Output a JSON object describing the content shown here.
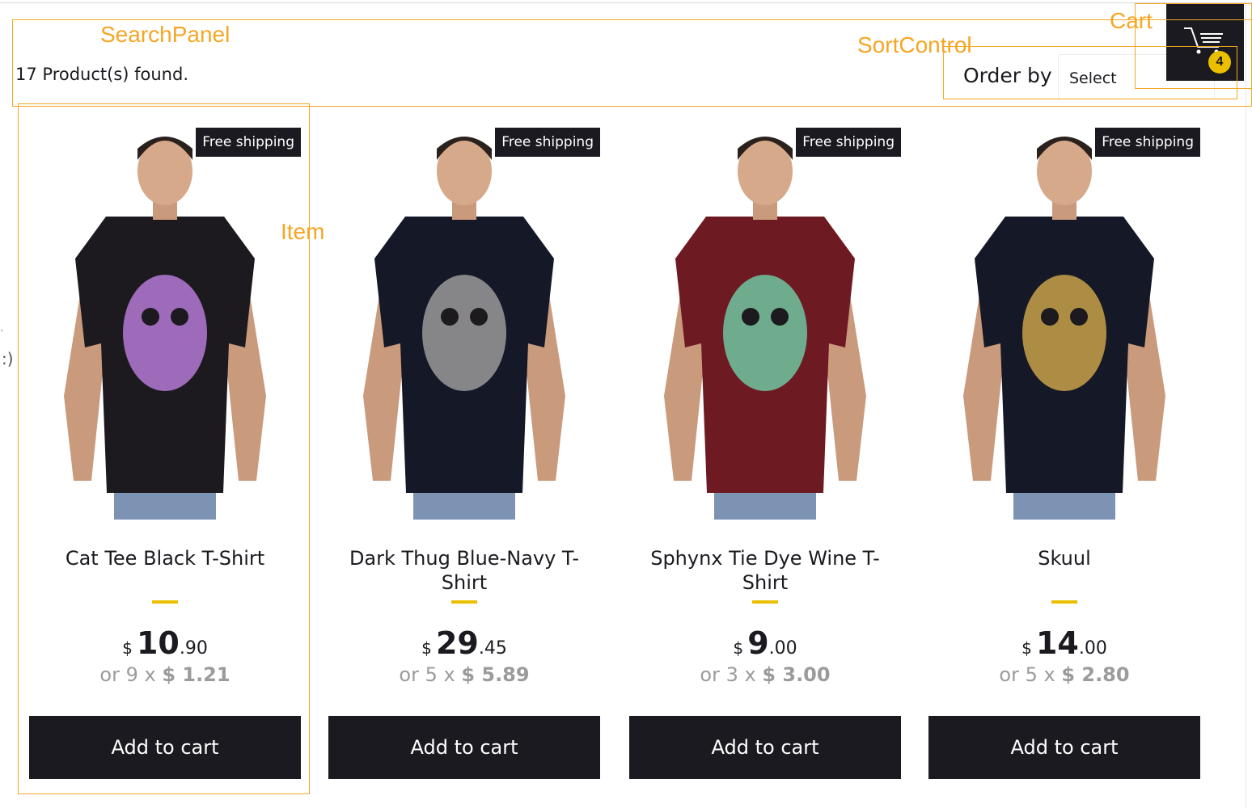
{
  "annotations": {
    "search_panel": "SearchPanel",
    "sort_control": "SortControl",
    "cart": "Cart",
    "item": "Item",
    "color": "#f5a623"
  },
  "search": {
    "products_found": "17 Product(s) found."
  },
  "sort": {
    "label": "Order by",
    "selected": "Select"
  },
  "cart": {
    "count": "4",
    "icon": "cart-icon"
  },
  "left_edge_text": ":)",
  "colors": {
    "dark": "#1b1a20",
    "accent": "#eabf00",
    "muted": "#9c9b9b"
  },
  "products": [
    {
      "badge": "Free shipping",
      "title": "Cat Tee Black T-Shirt",
      "currency": "$",
      "price_int": "10",
      "price_dec": ".90",
      "inst_prefix": "or 9 x",
      "inst_value": "$ 1.21",
      "button": "Add to cart",
      "image": "model-black-tshirt-cat-print",
      "shirt_color": "#1c1a1f",
      "print_color": "#b57ad6"
    },
    {
      "badge": "Free shipping",
      "title": "Dark Thug Blue-Navy T-Shirt",
      "currency": "$",
      "price_int": "29",
      "price_dec": ".45",
      "inst_prefix": "or 5 x",
      "inst_value": "$ 5.89",
      "button": "Add to cart",
      "image": "model-navy-tshirt-bandana-print",
      "shirt_color": "#141827",
      "print_color": "#9a9a9a"
    },
    {
      "badge": "Free shipping",
      "title": "Sphynx Tie Dye Wine T-Shirt",
      "currency": "$",
      "price_int": "9",
      "price_dec": ".00",
      "inst_prefix": "or 3 x",
      "inst_value": "$ 3.00",
      "button": "Add to cart",
      "image": "model-wine-tshirt-cat-print",
      "shirt_color": "#6e1a22",
      "print_color": "#6fc7a0"
    },
    {
      "badge": "Free shipping",
      "title": "Skuul",
      "currency": "$",
      "price_int": "14",
      "price_dec": ".00",
      "inst_prefix": "or 5 x",
      "inst_value": "$ 2.80",
      "button": "Add to cart",
      "image": "model-navy-tshirt-skull-print",
      "shirt_color": "#151826",
      "print_color": "#c8a24a"
    }
  ]
}
